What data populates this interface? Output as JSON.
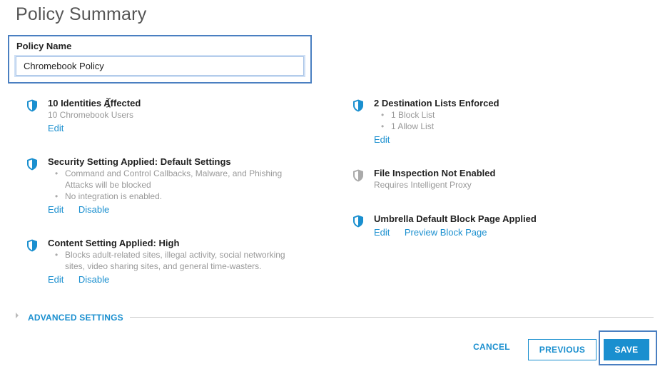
{
  "page": {
    "title": "Policy Summary"
  },
  "policy": {
    "label": "Policy Name",
    "value": "Chromebook Policy"
  },
  "identities": {
    "title": "10 Identities Affected",
    "subtitle": "10 Chromebook Users",
    "edit": "Edit",
    "icon": "shield-icon"
  },
  "security": {
    "title": "Security Setting Applied: Default Settings",
    "bullets": [
      "Command and Control Callbacks, Malware, and Phishing",
      "Attacks will be blocked",
      "No integration is enabled."
    ],
    "edit": "Edit",
    "disable": "Disable",
    "icon": "shield-icon"
  },
  "content": {
    "title": "Content Setting Applied: High",
    "bullets": [
      "Blocks adult-related sites, illegal activity, social networking",
      "sites, video sharing sites, and general time-wasters."
    ],
    "edit": "Edit",
    "disable": "Disable",
    "icon": "shield-icon"
  },
  "destinations": {
    "title": "2 Destination Lists Enforced",
    "bullets": [
      "1 Block List",
      "1 Allow List"
    ],
    "edit": "Edit",
    "icon": "shield-icon"
  },
  "file_inspection": {
    "title": "File Inspection Not Enabled",
    "subtitle": "Requires Intelligent Proxy",
    "icon": "shield-disabled-icon"
  },
  "block_page": {
    "title": "Umbrella Default Block Page Applied",
    "edit": "Edit",
    "preview": "Preview Block Page",
    "icon": "shield-icon"
  },
  "advanced": {
    "label": "ADVANCED SETTINGS"
  },
  "buttons": {
    "cancel": "CANCEL",
    "previous": "PREVIOUS",
    "save": "SAVE"
  },
  "colors": {
    "accent": "#1a8fcf",
    "shield_active": "#1a8fcf",
    "shield_inactive": "#aaaaaa",
    "focus_outline": "#4a7fc1"
  }
}
